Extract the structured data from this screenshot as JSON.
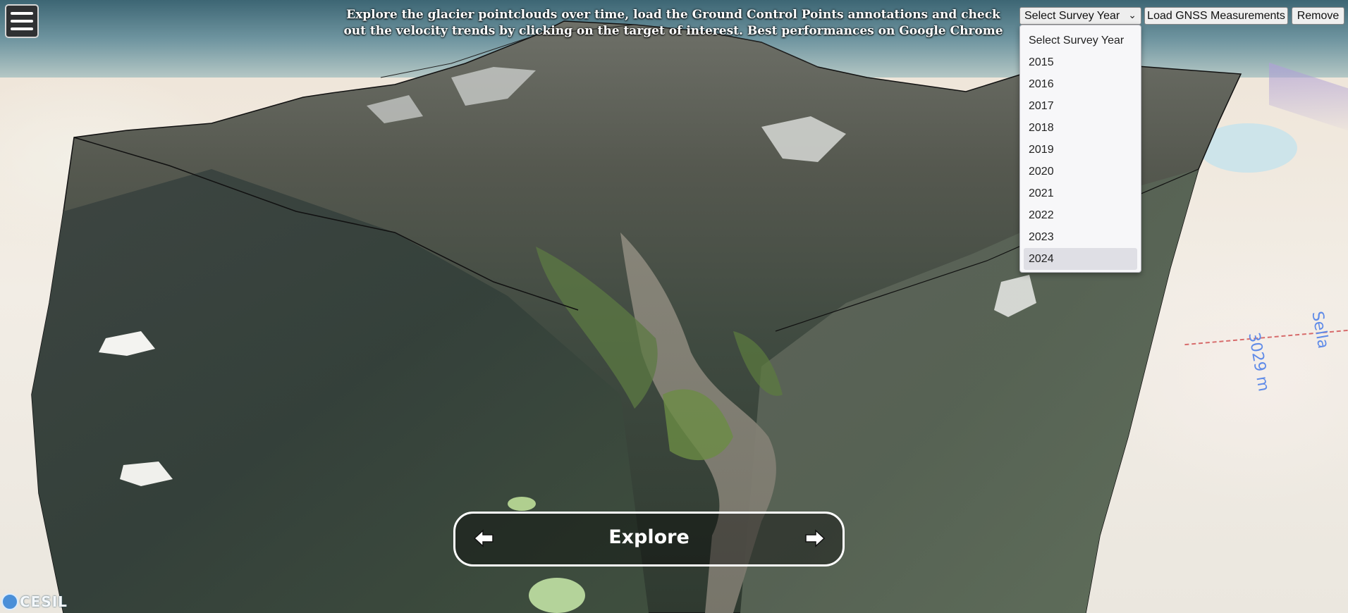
{
  "header": {
    "description": "Explore the glacier pointclouds over time, load the Ground Control Points annotations and check out the velocity trends by clicking on the target of interest. Best performances on Google Chrome"
  },
  "menu": {
    "icon": "hamburger-menu-icon"
  },
  "toolbar": {
    "year_select": {
      "selected": "Select Survey Year",
      "options": [
        "Select Survey Year",
        "2015",
        "2016",
        "2017",
        "2018",
        "2019",
        "2020",
        "2021",
        "2022",
        "2023",
        "2024"
      ],
      "highlighted": "2024",
      "expanded": true
    },
    "gnss_label": "Load GNSS Measurements",
    "remove_label": "Remove"
  },
  "explore_nav": {
    "title": "Explore",
    "prev_icon": "arrow-left-icon",
    "next_icon": "arrow-right-icon"
  },
  "credits": {
    "logo_text": "CESIL"
  },
  "colors": {
    "dropdown_bg": "#f7f7f9",
    "dropdown_highlight": "#dfdfe5",
    "explore_border": "#ffffff",
    "map_label": "#5f8be8"
  }
}
